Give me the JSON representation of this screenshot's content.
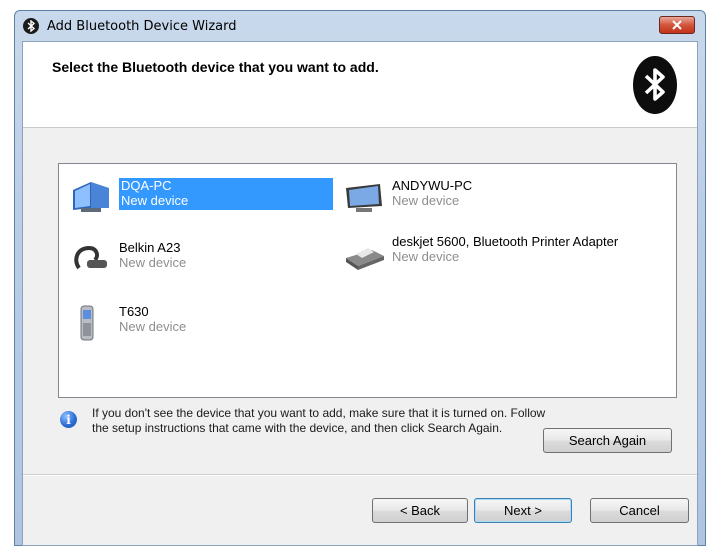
{
  "window": {
    "title": "Add Bluetooth Device Wizard"
  },
  "header": {
    "title": "Select the Bluetooth device that you want to add."
  },
  "devices": [
    {
      "name": "DQA-PC",
      "status": "New device",
      "icon": "computer-icon",
      "selected": true
    },
    {
      "name": "ANDYWU-PC",
      "status": "New device",
      "icon": "computer-icon",
      "selected": false
    },
    {
      "name": "Belkin A23",
      "status": "New device",
      "icon": "headset-icon",
      "selected": false
    },
    {
      "name": "deskjet 5600, Bluetooth Printer Adapter",
      "status": "New device",
      "icon": "printer-icon",
      "selected": false
    },
    {
      "name": "T630",
      "status": "New device",
      "icon": "phone-icon",
      "selected": false
    }
  ],
  "info": {
    "text": "If you don't see the device that you want to add, make sure that it is turned on. Follow the setup instructions that came with the device, and then click Search Again."
  },
  "buttons": {
    "search_again": "Search Again",
    "back": "< Back",
    "next": "Next >",
    "cancel": "Cancel"
  },
  "colors": {
    "selection": "#3399ff",
    "status_text": "#8e8e8e",
    "close_button": "#c2331a"
  }
}
